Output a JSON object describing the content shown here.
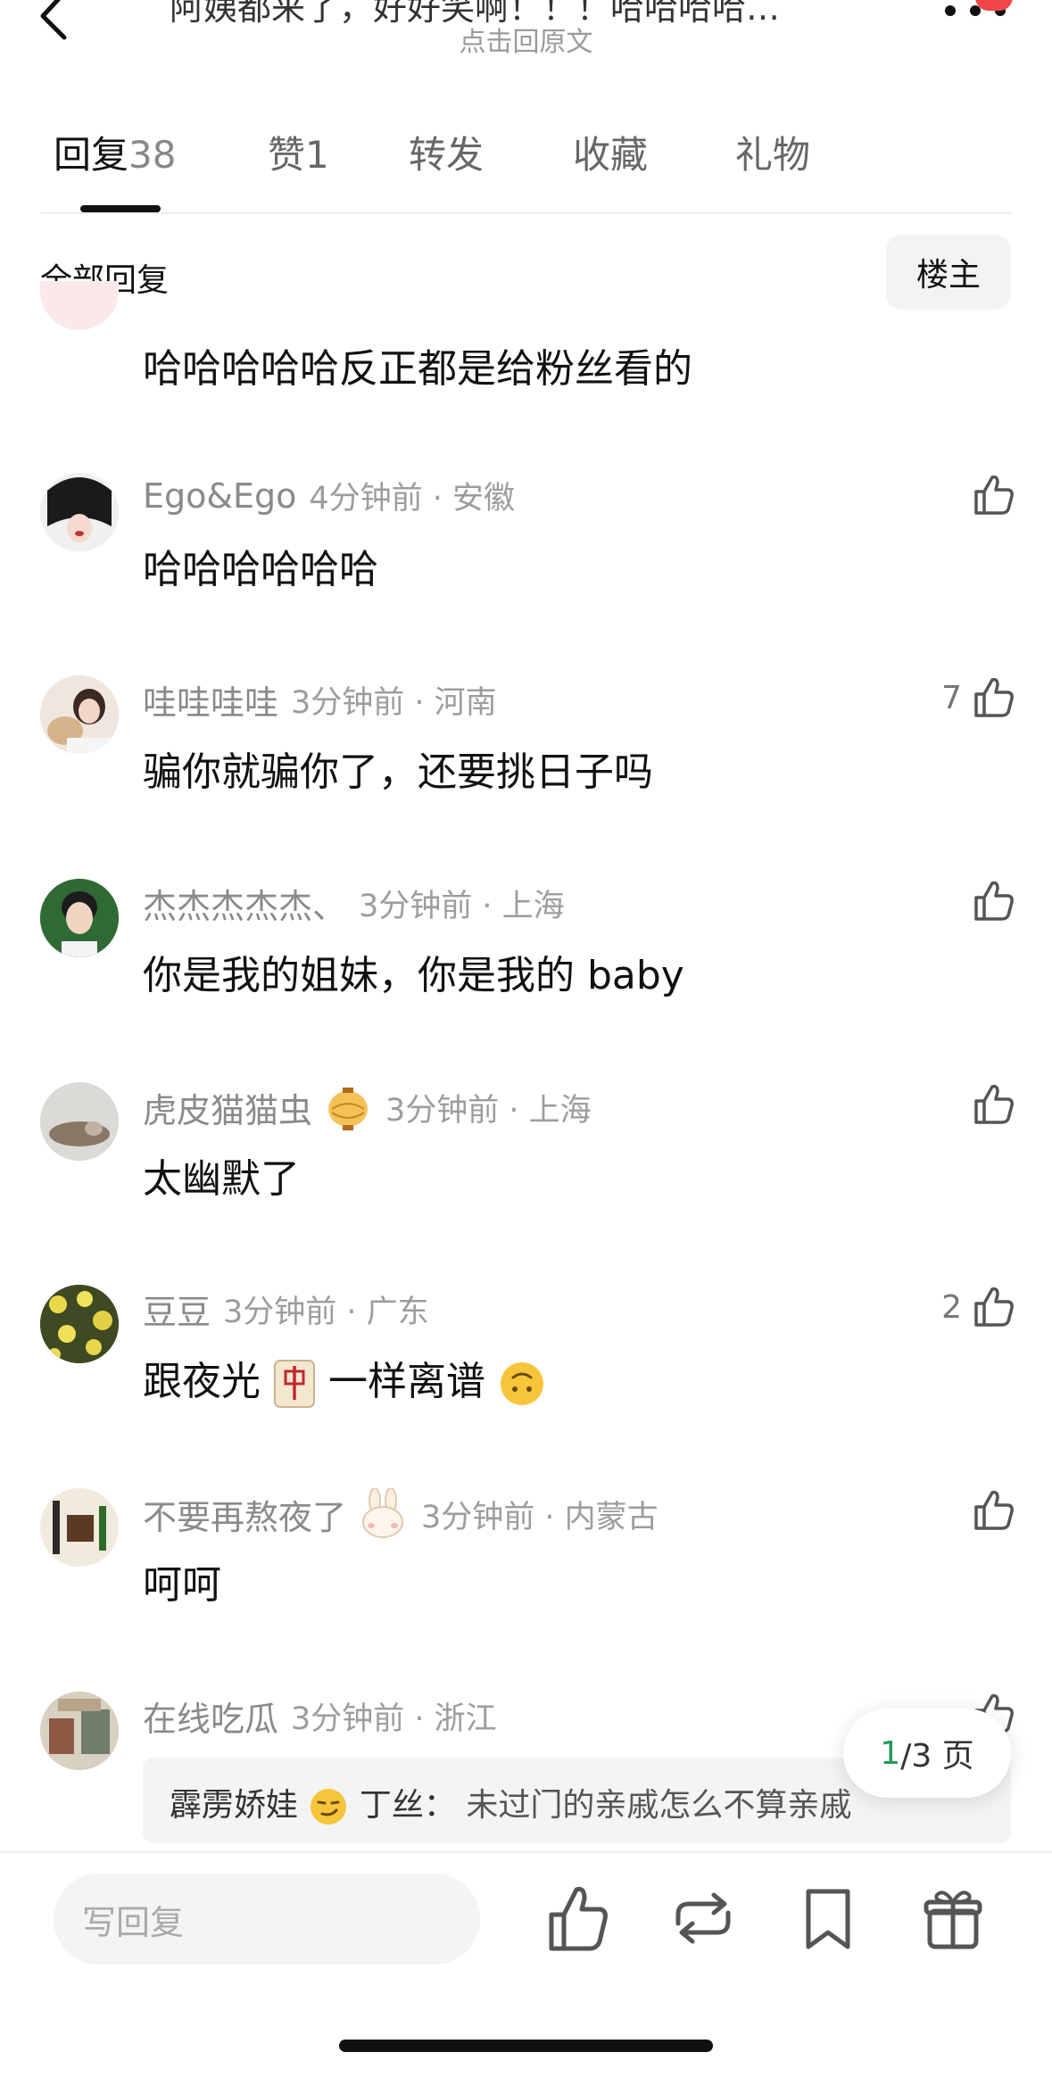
{
  "header": {
    "title": "阿姨都来了，好好笑啊！！！哈哈哈哈…",
    "subtitle": "点击回原文"
  },
  "tabs": [
    {
      "label": "回复",
      "count": "38"
    },
    {
      "label": "赞",
      "count": "1"
    },
    {
      "label": "转发",
      "count": ""
    },
    {
      "label": "收藏",
      "count": ""
    },
    {
      "label": "礼物",
      "count": ""
    }
  ],
  "section": {
    "title": "全部回复",
    "owner_button": "楼主"
  },
  "comments": [
    {
      "text": "哈哈哈哈哈反正都是给粉丝看的"
    },
    {
      "name": "Ego&Ego",
      "time": "4分钟前 · 安徽",
      "text": "哈哈哈哈哈哈",
      "likes": ""
    },
    {
      "name": "哇哇哇哇",
      "time": "3分钟前 · 河南",
      "text": "骗你就骗你了，还要挑日子吗",
      "likes": "7"
    },
    {
      "name": "杰杰杰杰杰、",
      "time": "3分钟前 · 上海",
      "text": "你是我的姐妹，你是我的 baby",
      "likes": ""
    },
    {
      "name": "虎皮猫猫虫",
      "time": "3分钟前 · 上海",
      "text": "太幽默了",
      "likes": "",
      "badge": "lantern-icon"
    },
    {
      "name": "豆豆",
      "time": "3分钟前 · 广东",
      "text_before": "跟夜光",
      "text_after": "一样离谱",
      "likes": "2",
      "emoji": [
        "mahjong-zhong-icon",
        "upside-down-face-icon"
      ]
    },
    {
      "name": "不要再熬夜了",
      "time": "3分钟前 · 内蒙古",
      "text": "呵呵",
      "likes": "",
      "badge": "rabbit-icon"
    },
    {
      "name": "在线吃瓜",
      "time": "3分钟前 · 浙江",
      "likes": "",
      "quote": {
        "author": "霹雳娇娃",
        "author_suffix": "丁丝：",
        "text": "未过门的亲戚怎么不算亲戚"
      }
    }
  ],
  "pager": {
    "current": "1",
    "total_text": "/3 页"
  },
  "bottom_bar": {
    "placeholder": "写回复"
  },
  "colors": {
    "accent_green": "#1d9e58",
    "badge_red": "#f2464b"
  }
}
